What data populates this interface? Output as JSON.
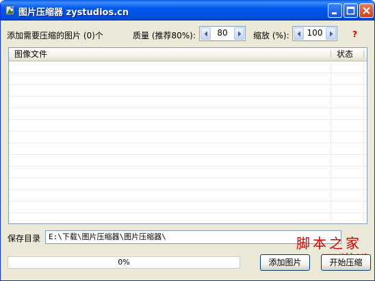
{
  "window": {
    "title": "图片压缩器 zystudios.cn",
    "buttons": [
      "minimize",
      "maximize",
      "close"
    ]
  },
  "toolbar": {
    "files_added_label": "添加需要压缩的图片 (0)个",
    "quality_label": "质量 (推荐80%):",
    "quality_value": "80",
    "scale_label": "缩放 (%):",
    "scale_value": "100",
    "help_icon": "?"
  },
  "list": {
    "columns": [
      "图像文件",
      "状态"
    ],
    "rows": []
  },
  "save": {
    "label": "保存目录",
    "path": "E:\\下载\\图片压缩器\\图片压缩器\\",
    "browse": "..."
  },
  "progress": {
    "percent": 0,
    "text": "0%"
  },
  "actions": {
    "add_button": "添加图片",
    "start_button": "开始压缩"
  },
  "watermark": {
    "text": "脚本之家",
    "url": "www.jb51.net"
  },
  "colors": {
    "titlebar": "#0054e3",
    "window_bg": "#ece9d8",
    "help": "#e20000",
    "watermark": "#d40000"
  }
}
